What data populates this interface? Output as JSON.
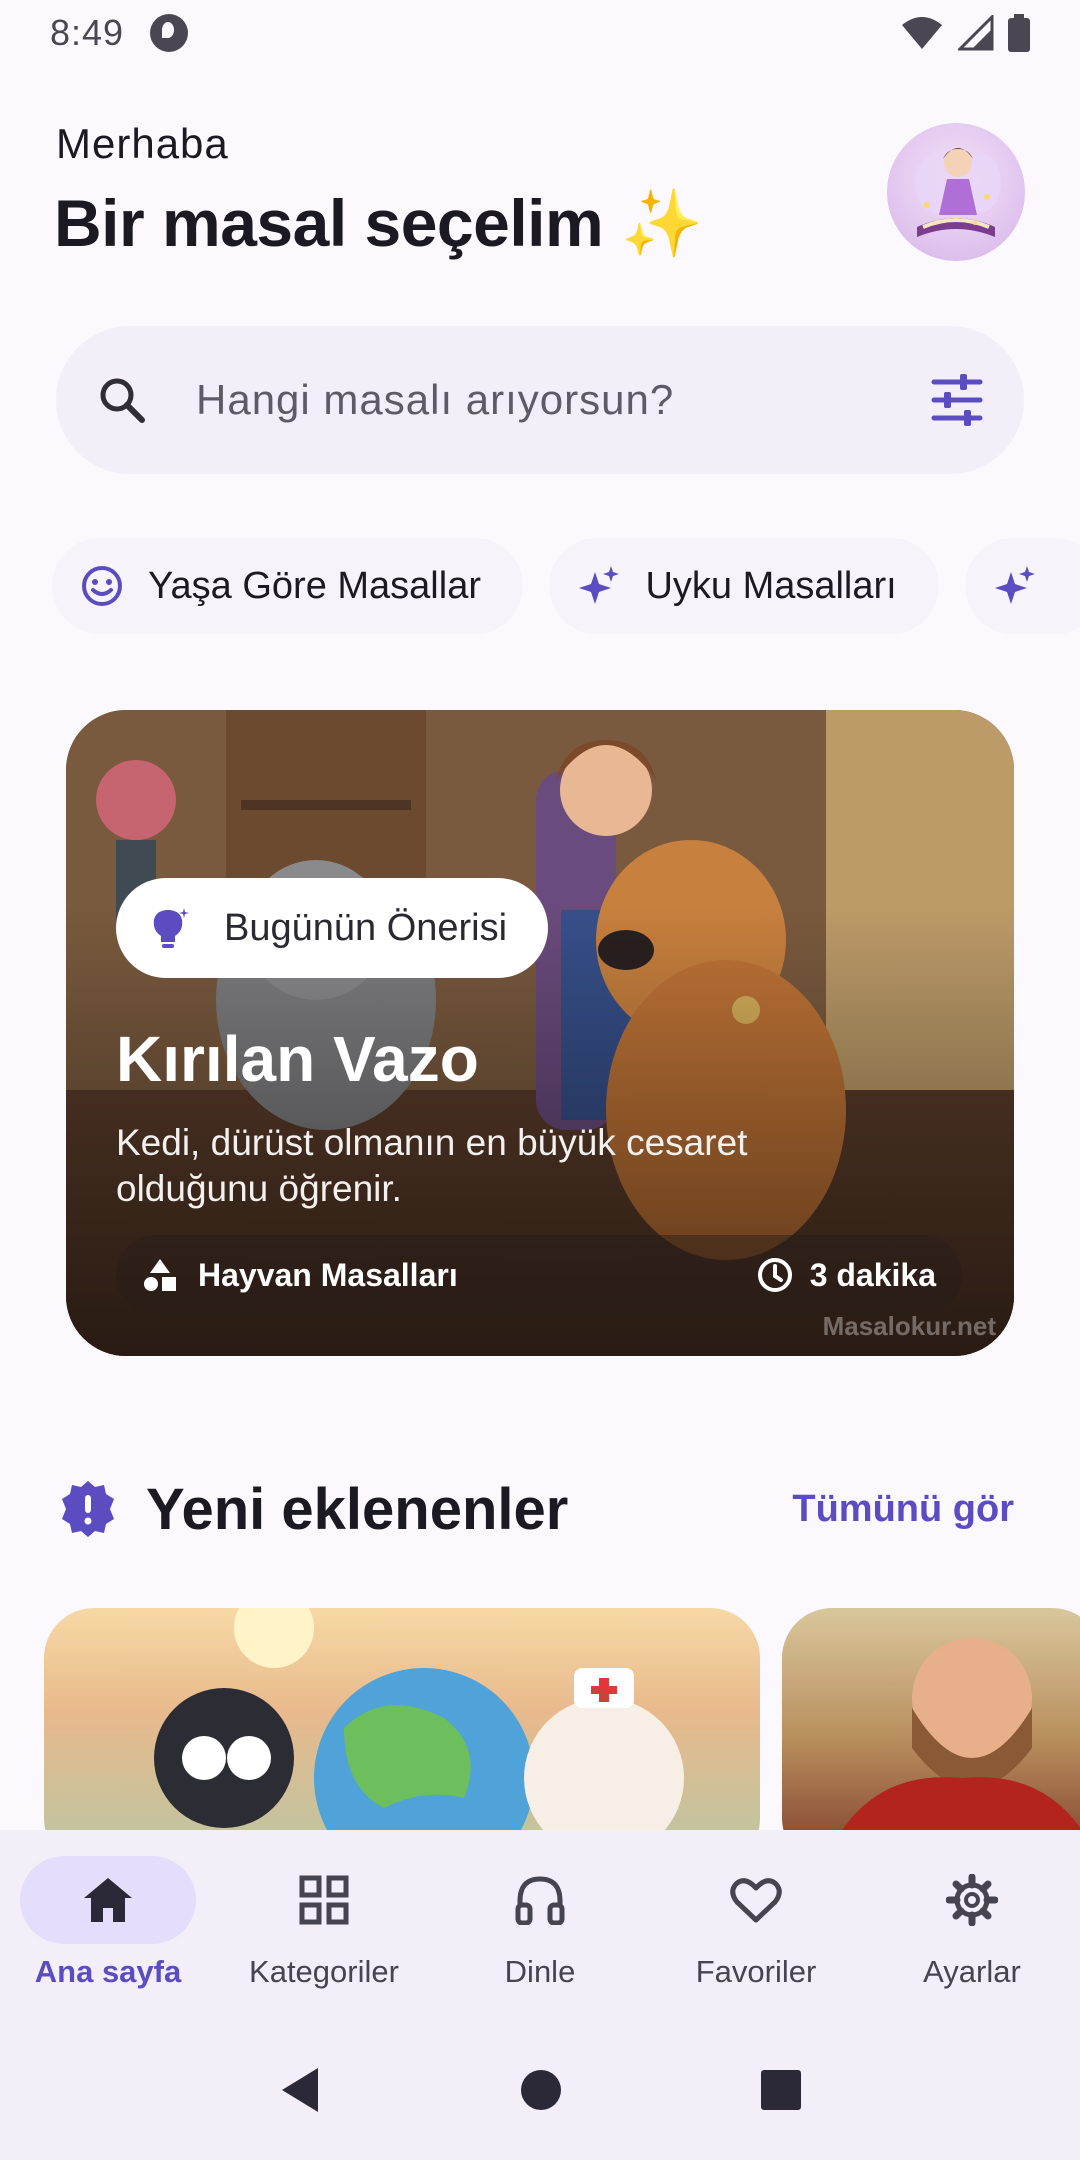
{
  "status_bar": {
    "time": "8:49",
    "icons": [
      "app-notification-icon",
      "wifi-icon",
      "signal-icon",
      "battery-icon"
    ]
  },
  "header": {
    "greeting": "Merhaba",
    "headline": "Bir masal seçelim ✨"
  },
  "search": {
    "placeholder": "Hangi masalı arıyorsun?",
    "icons": [
      "search-icon",
      "filter-sliders-icon"
    ]
  },
  "chips": [
    {
      "label": "Yaşa Göre Masallar",
      "icon": "smiley-face-icon"
    },
    {
      "label": "Uyku Masalları",
      "icon": "sparkles-icon"
    }
  ],
  "featured": {
    "badge": "Bugünün Önerisi",
    "title": "Kırılan Vazo",
    "description": "Kedi, dürüst olmanın en büyük cesaret olduğunu öğrenir.",
    "category": "Hayvan Masalları",
    "duration": "3 dakika",
    "watermark": "Masalokur.net"
  },
  "new_section": {
    "title": "Yeni eklenenler",
    "see_all": "Tümünü gör"
  },
  "bottom_nav": [
    {
      "label": "Ana sayfa",
      "icon": "home-icon",
      "active": true
    },
    {
      "label": "Kategoriler",
      "icon": "grid-icon",
      "active": false
    },
    {
      "label": "Dinle",
      "icon": "headphones-icon",
      "active": false
    },
    {
      "label": "Favoriler",
      "icon": "heart-icon",
      "active": false
    },
    {
      "label": "Ayarlar",
      "icon": "settings-gear-icon",
      "active": false
    }
  ],
  "colors": {
    "accent": "#5B4DC1",
    "background": "#FBF8FE",
    "nav_active": "#E4DDFB"
  }
}
